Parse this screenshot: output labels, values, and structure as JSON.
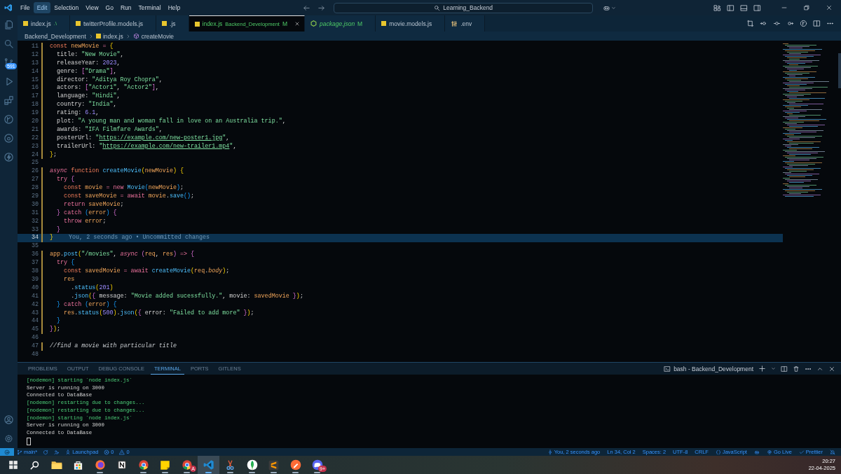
{
  "title_bar": {
    "menu": [
      {
        "label": "File",
        "selected": false
      },
      {
        "label": "Edit",
        "selected": true
      },
      {
        "label": "Selection",
        "selected": false
      },
      {
        "label": "View",
        "selected": false
      },
      {
        "label": "Go",
        "selected": false
      },
      {
        "label": "Run",
        "selected": false
      },
      {
        "label": "Terminal",
        "selected": false
      },
      {
        "label": "Help",
        "selected": false
      }
    ],
    "search": {
      "value": "Learning_Backend"
    }
  },
  "activity_bar": {
    "top": [
      {
        "kind": "explorer"
      },
      {
        "kind": "search"
      },
      {
        "kind": "source-control",
        "badge": "591"
      },
      {
        "kind": "run"
      },
      {
        "kind": "extensions"
      },
      {
        "kind": "graph"
      },
      {
        "kind": "remote"
      },
      {
        "kind": "bolt"
      }
    ],
    "bottom": [
      {
        "kind": "account"
      },
      {
        "kind": "settings"
      }
    ]
  },
  "tabs": [
    {
      "label": "index.js",
      "description": ".\\",
      "kind": "js",
      "selected": false,
      "preview": false
    },
    {
      "label": "twitterProfile.models.js",
      "kind": "js",
      "selected": false,
      "preview": false
    },
    {
      "label": ".js",
      "kind": "js",
      "selected": false,
      "preview": false
    },
    {
      "label": "index.js",
      "description": "Backend_Development",
      "git_status": "M",
      "kind": "js",
      "selected": true,
      "preview": false
    },
    {
      "label": "package.json",
      "git_status": "M",
      "kind": "node",
      "selected": false,
      "preview": true
    },
    {
      "label": "movie.models.js",
      "kind": "js",
      "selected": false,
      "preview": false
    },
    {
      "label": ".env",
      "kind": "env",
      "selected": false,
      "preview": false
    }
  ],
  "breadcrumb": [
    {
      "label": "Backend_Development",
      "kind": "folder"
    },
    {
      "label": "index.js",
      "kind": "js"
    },
    {
      "label": "createMovie",
      "kind": "symbol"
    }
  ],
  "editor": {
    "lines": [
      {
        "n": "11",
        "changed": true,
        "current": false,
        "tokens": [
          {
            "t": "const ",
            "kind": "kw"
          },
          {
            "t": "newMovie",
            "kind": "var"
          },
          {
            "t": " = ",
            "kind": "op"
          },
          {
            "t": "{",
            "kind": "p1"
          }
        ]
      },
      {
        "n": "12",
        "changed": true,
        "current": false,
        "tokens": [
          {
            "t": "  title: ",
            "kind": "plain"
          },
          {
            "t": "\"New Movie\"",
            "kind": "str"
          },
          {
            "t": ",",
            "kind": "plain"
          }
        ]
      },
      {
        "n": "13",
        "changed": true,
        "current": false,
        "tokens": [
          {
            "t": "  releaseYear: ",
            "kind": "plain"
          },
          {
            "t": "2023",
            "kind": "num"
          },
          {
            "t": ",",
            "kind": "plain"
          }
        ]
      },
      {
        "n": "14",
        "changed": true,
        "current": false,
        "tokens": [
          {
            "t": "  genre: ",
            "kind": "plain"
          },
          {
            "t": "[",
            "kind": "p2"
          },
          {
            "t": "\"Drama\"",
            "kind": "str"
          },
          {
            "t": "]",
            "kind": "p2"
          },
          {
            "t": ",",
            "kind": "plain"
          }
        ]
      },
      {
        "n": "15",
        "changed": true,
        "current": false,
        "tokens": [
          {
            "t": "  director: ",
            "kind": "plain"
          },
          {
            "t": "\"Aditya Roy Chopra\"",
            "kind": "str"
          },
          {
            "t": ",",
            "kind": "plain"
          }
        ]
      },
      {
        "n": "16",
        "changed": true,
        "current": false,
        "tokens": [
          {
            "t": "  actors: ",
            "kind": "plain"
          },
          {
            "t": "[",
            "kind": "p2"
          },
          {
            "t": "\"Actor1\"",
            "kind": "str"
          },
          {
            "t": ", ",
            "kind": "plain"
          },
          {
            "t": "\"Actor2\"",
            "kind": "str"
          },
          {
            "t": "]",
            "kind": "p2"
          },
          {
            "t": ",",
            "kind": "plain"
          }
        ]
      },
      {
        "n": "17",
        "changed": true,
        "current": false,
        "tokens": [
          {
            "t": "  language: ",
            "kind": "plain"
          },
          {
            "t": "\"Hindi\"",
            "kind": "str"
          },
          {
            "t": ",",
            "kind": "plain"
          }
        ]
      },
      {
        "n": "18",
        "changed": true,
        "current": false,
        "tokens": [
          {
            "t": "  country: ",
            "kind": "plain"
          },
          {
            "t": "\"India\"",
            "kind": "str"
          },
          {
            "t": ",",
            "kind": "plain"
          }
        ]
      },
      {
        "n": "19",
        "changed": true,
        "current": false,
        "tokens": [
          {
            "t": "  rating: ",
            "kind": "plain"
          },
          {
            "t": "6.1",
            "kind": "num"
          },
          {
            "t": ",",
            "kind": "plain"
          }
        ]
      },
      {
        "n": "20",
        "changed": true,
        "current": false,
        "tokens": [
          {
            "t": "  plot: ",
            "kind": "plain"
          },
          {
            "t": "\"A young man and woman fall in love on an Australia trip.\"",
            "kind": "str"
          },
          {
            "t": ",",
            "kind": "plain"
          }
        ]
      },
      {
        "n": "21",
        "changed": true,
        "current": false,
        "tokens": [
          {
            "t": "  awards: ",
            "kind": "plain"
          },
          {
            "t": "\"IFA Filmfare Awards\"",
            "kind": "str"
          },
          {
            "t": ",",
            "kind": "plain"
          }
        ]
      },
      {
        "n": "22",
        "changed": true,
        "current": false,
        "tokens": [
          {
            "t": "  posterUrl: ",
            "kind": "plain"
          },
          {
            "t": "\"",
            "kind": "str"
          },
          {
            "t": "https://example.com/new-poster1.jpg",
            "kind": "link"
          },
          {
            "t": "\"",
            "kind": "str"
          },
          {
            "t": ",",
            "kind": "plain"
          }
        ]
      },
      {
        "n": "23",
        "changed": true,
        "current": false,
        "tokens": [
          {
            "t": "  trailerUrl: ",
            "kind": "plain"
          },
          {
            "t": "\"",
            "kind": "str"
          },
          {
            "t": "https://example.com/new-trailer1.mp4",
            "kind": "link"
          },
          {
            "t": "\"",
            "kind": "str"
          },
          {
            "t": ",",
            "kind": "plain"
          }
        ]
      },
      {
        "n": "24",
        "changed": true,
        "current": false,
        "tokens": [
          {
            "t": "}",
            "kind": "p1"
          },
          {
            "t": ";",
            "kind": "plain"
          }
        ]
      },
      {
        "n": "25",
        "changed": false,
        "current": false
      },
      {
        "n": "26",
        "changed": true,
        "current": false,
        "tokens": [
          {
            "t": "async ",
            "kind": "it"
          },
          {
            "t": "function ",
            "kind": "kw"
          },
          {
            "t": "createMovie",
            "kind": "fn"
          },
          {
            "t": "(",
            "kind": "p1"
          },
          {
            "t": "newMovie",
            "kind": "var"
          },
          {
            "t": ") {",
            "kind": "p1"
          }
        ]
      },
      {
        "n": "27",
        "changed": true,
        "current": false,
        "tokens": [
          {
            "t": "  try ",
            "kind": "ctl"
          },
          {
            "t": "{",
            "kind": "p2"
          }
        ]
      },
      {
        "n": "28",
        "changed": true,
        "current": false,
        "tokens": [
          {
            "t": "    const ",
            "kind": "kw"
          },
          {
            "t": "movie",
            "kind": "var"
          },
          {
            "t": " = new ",
            "kind": "ctl"
          },
          {
            "t": "Movie",
            "kind": "fn"
          },
          {
            "t": "(",
            "kind": "p3"
          },
          {
            "t": "newMovie",
            "kind": "var"
          },
          {
            "t": ")",
            "kind": "p3"
          },
          {
            "t": ";",
            "kind": "plain"
          }
        ]
      },
      {
        "n": "29",
        "changed": true,
        "current": false,
        "tokens": [
          {
            "t": "    const ",
            "kind": "kw"
          },
          {
            "t": "saveMovie",
            "kind": "var"
          },
          {
            "t": " = await ",
            "kind": "ctl"
          },
          {
            "t": "movie",
            "kind": "var"
          },
          {
            "t": ".",
            "kind": "plain"
          },
          {
            "t": "save",
            "kind": "fn"
          },
          {
            "t": "()",
            "kind": "p3"
          },
          {
            "t": ";",
            "kind": "plain"
          }
        ]
      },
      {
        "n": "30",
        "changed": true,
        "current": false,
        "tokens": [
          {
            "t": "    return ",
            "kind": "ctl"
          },
          {
            "t": "saveMovie",
            "kind": "var"
          },
          {
            "t": ";",
            "kind": "plain"
          }
        ]
      },
      {
        "n": "31",
        "changed": true,
        "current": false,
        "tokens": [
          {
            "t": "  }",
            "kind": "p2"
          },
          {
            "t": " catch ",
            "kind": "ctl"
          },
          {
            "t": "(",
            "kind": "p3"
          },
          {
            "t": "error",
            "kind": "var"
          },
          {
            "t": ")",
            "kind": "p3"
          },
          {
            "t": " {",
            "kind": "p2"
          }
        ]
      },
      {
        "n": "32",
        "changed": true,
        "current": false,
        "tokens": [
          {
            "t": "    throw ",
            "kind": "ctl"
          },
          {
            "t": "error",
            "kind": "var"
          },
          {
            "t": ";",
            "kind": "plain"
          }
        ]
      },
      {
        "n": "33",
        "changed": true,
        "current": false,
        "tokens": [
          {
            "t": "  }",
            "kind": "p2"
          }
        ]
      },
      {
        "n": "34",
        "changed": true,
        "current": true,
        "blame": "You, 2 seconds ago • Uncommitted changes",
        "tokens": [
          {
            "t": "}",
            "kind": "p1"
          }
        ]
      },
      {
        "n": "35",
        "changed": false,
        "current": false
      },
      {
        "n": "36",
        "changed": true,
        "current": false,
        "tokens": [
          {
            "t": "app",
            "kind": "var"
          },
          {
            "t": ".",
            "kind": "plain"
          },
          {
            "t": "post",
            "kind": "fn"
          },
          {
            "t": "(",
            "kind": "p1"
          },
          {
            "t": "\"/movies\"",
            "kind": "str"
          },
          {
            "t": ", ",
            "kind": "plain"
          },
          {
            "t": "async ",
            "kind": "it"
          },
          {
            "t": "(",
            "kind": "p2"
          },
          {
            "t": "req",
            "kind": "var"
          },
          {
            "t": ", ",
            "kind": "plain"
          },
          {
            "t": "res",
            "kind": "var"
          },
          {
            "t": ")",
            "kind": "p2"
          },
          {
            "t": " => ",
            "kind": "ctl"
          },
          {
            "t": "{",
            "kind": "p2"
          }
        ]
      },
      {
        "n": "37",
        "changed": true,
        "current": false,
        "tokens": [
          {
            "t": "  try ",
            "kind": "ctl"
          },
          {
            "t": "{",
            "kind": "p3"
          }
        ]
      },
      {
        "n": "38",
        "changed": true,
        "current": false,
        "tokens": [
          {
            "t": "    const ",
            "kind": "kw"
          },
          {
            "t": "savedMovie",
            "kind": "var"
          },
          {
            "t": " = await ",
            "kind": "ctl"
          },
          {
            "t": "createMovie",
            "kind": "fn"
          },
          {
            "t": "(",
            "kind": "p1"
          },
          {
            "t": "req",
            "kind": "var"
          },
          {
            "t": ".",
            "kind": "plain"
          },
          {
            "t": "body",
            "kind": "itv"
          },
          {
            "t": ")",
            "kind": "p1"
          },
          {
            "t": ";",
            "kind": "plain"
          }
        ]
      },
      {
        "n": "39",
        "changed": true,
        "current": false,
        "tokens": [
          {
            "t": "    res",
            "kind": "var"
          }
        ]
      },
      {
        "n": "40",
        "changed": true,
        "current": false,
        "tokens": [
          {
            "t": "      .",
            "kind": "plain"
          },
          {
            "t": "status",
            "kind": "fn"
          },
          {
            "t": "(",
            "kind": "p1"
          },
          {
            "t": "201",
            "kind": "num"
          },
          {
            "t": ")",
            "kind": "p1"
          }
        ]
      },
      {
        "n": "41",
        "changed": true,
        "current": false,
        "tokens": [
          {
            "t": "      .",
            "kind": "plain"
          },
          {
            "t": "json",
            "kind": "fn"
          },
          {
            "t": "(",
            "kind": "p1"
          },
          {
            "t": "{",
            "kind": "p2"
          },
          {
            "t": " message: ",
            "kind": "plain"
          },
          {
            "t": "\"Movie added sucessfully.\"",
            "kind": "str"
          },
          {
            "t": ", movie: ",
            "kind": "plain"
          },
          {
            "t": "savedMovie",
            "kind": "var"
          },
          {
            "t": " }",
            "kind": "p2"
          },
          {
            "t": ")",
            "kind": "p1"
          },
          {
            "t": ";",
            "kind": "plain"
          }
        ]
      },
      {
        "n": "42",
        "changed": true,
        "current": false,
        "tokens": [
          {
            "t": "  }",
            "kind": "p3"
          },
          {
            "t": " catch ",
            "kind": "ctl"
          },
          {
            "t": "(",
            "kind": "p3"
          },
          {
            "t": "error",
            "kind": "var"
          },
          {
            "t": ")",
            "kind": "p3"
          },
          {
            "t": " {",
            "kind": "p3"
          }
        ]
      },
      {
        "n": "43",
        "changed": true,
        "current": false,
        "tokens": [
          {
            "t": "    res",
            "kind": "var"
          },
          {
            "t": ".",
            "kind": "plain"
          },
          {
            "t": "status",
            "kind": "fn"
          },
          {
            "t": "(",
            "kind": "p1"
          },
          {
            "t": "500",
            "kind": "num"
          },
          {
            "t": ")",
            "kind": "p1"
          },
          {
            "t": ".",
            "kind": "plain"
          },
          {
            "t": "json",
            "kind": "fn"
          },
          {
            "t": "(",
            "kind": "p1"
          },
          {
            "t": "{",
            "kind": "p2"
          },
          {
            "t": " error: ",
            "kind": "plain"
          },
          {
            "t": "\"Failed to add more\"",
            "kind": "str"
          },
          {
            "t": " }",
            "kind": "p2"
          },
          {
            "t": ")",
            "kind": "p1"
          },
          {
            "t": ";",
            "kind": "plain"
          }
        ]
      },
      {
        "n": "44",
        "changed": true,
        "current": false,
        "tokens": [
          {
            "t": "  }",
            "kind": "p3"
          }
        ]
      },
      {
        "n": "45",
        "changed": true,
        "current": false,
        "tokens": [
          {
            "t": "}",
            "kind": "p2"
          },
          {
            "t": ")",
            "kind": "p1"
          },
          {
            "t": ";",
            "kind": "plain"
          }
        ]
      },
      {
        "n": "46",
        "changed": false,
        "current": false
      },
      {
        "n": "47",
        "changed": true,
        "current": false,
        "tokens": [
          {
            "t": "//find a movie with particular title",
            "kind": "cm"
          }
        ]
      },
      {
        "n": "48",
        "changed": false,
        "current": false
      }
    ]
  },
  "panel": {
    "tabs": [
      {
        "label": "PROBLEMS",
        "selected": false
      },
      {
        "label": "OUTPUT",
        "selected": false
      },
      {
        "label": "DEBUG CONSOLE",
        "selected": false
      },
      {
        "label": "TERMINAL",
        "selected": true
      },
      {
        "label": "PORTS",
        "selected": false
      },
      {
        "label": "GITLENS",
        "selected": false
      }
    ],
    "terminal_title": "bash - Backend_Development",
    "lines": [
      {
        "kind": "nodemon",
        "text": "[nodemon] starting `node index.js`"
      },
      {
        "kind": "output",
        "text": "Server is running on 3000"
      },
      {
        "kind": "output",
        "text": "Connected to DataBase"
      },
      {
        "kind": "nodemon",
        "text": "[nodemon] restarting due to changes..."
      },
      {
        "kind": "nodemon",
        "text": "[nodemon] restarting due to changes..."
      },
      {
        "kind": "nodemon",
        "text": "[nodemon] starting `node index.js`"
      },
      {
        "kind": "output",
        "text": "Server is running on 3000"
      },
      {
        "kind": "output",
        "text": "Connected to DataBase"
      }
    ]
  },
  "status_bar": {
    "left": [
      {
        "kind": "remote"
      },
      {
        "kind": "branch",
        "label": "main*"
      },
      {
        "kind": "sync"
      },
      {
        "kind": "live-share"
      },
      {
        "kind": "launchpad",
        "label": "Launchpad"
      },
      {
        "kind": "errors",
        "label": "0"
      },
      {
        "kind": "warnings",
        "label": "0"
      }
    ],
    "right": [
      {
        "kind": "blame",
        "label": "You, 2 seconds ago"
      },
      {
        "kind": "text",
        "label": "Ln 34, Col 2"
      },
      {
        "kind": "text",
        "label": "Spaces: 2"
      },
      {
        "kind": "text",
        "label": "UTF-8"
      },
      {
        "kind": "text",
        "label": "CRLF"
      },
      {
        "kind": "language",
        "label": "JavaScript"
      },
      {
        "kind": "copilot"
      },
      {
        "kind": "golive",
        "label": "Go Live"
      },
      {
        "kind": "prettier",
        "label": "Prettier"
      },
      {
        "kind": "bell"
      }
    ]
  },
  "taskbar": {
    "apps": [
      {
        "kind": "windows",
        "selected": false,
        "running": false
      },
      {
        "kind": "search",
        "selected": false,
        "running": false
      },
      {
        "kind": "folder",
        "selected": false,
        "running": false
      },
      {
        "kind": "store",
        "selected": false,
        "running": false
      },
      {
        "kind": "firefox",
        "selected": false,
        "running": true
      },
      {
        "kind": "notion",
        "selected": false,
        "running": false
      },
      {
        "kind": "chrome",
        "selected": false,
        "running": true
      },
      {
        "kind": "sticky",
        "selected": false,
        "running": true
      },
      {
        "kind": "chrome",
        "badge": "A",
        "selected": false,
        "running": true
      },
      {
        "kind": "vscode",
        "selected": true,
        "running": true
      },
      {
        "kind": "snip",
        "selected": false,
        "running": true
      },
      {
        "kind": "leaf",
        "selected": false,
        "running": true
      },
      {
        "kind": "sublime",
        "selected": false,
        "running": true
      },
      {
        "kind": "postman",
        "selected": false,
        "running": true
      },
      {
        "kind": "discord",
        "badge": "9+",
        "selected": false,
        "running": true
      }
    ],
    "time": "20:27",
    "date": "22-04-2025"
  }
}
